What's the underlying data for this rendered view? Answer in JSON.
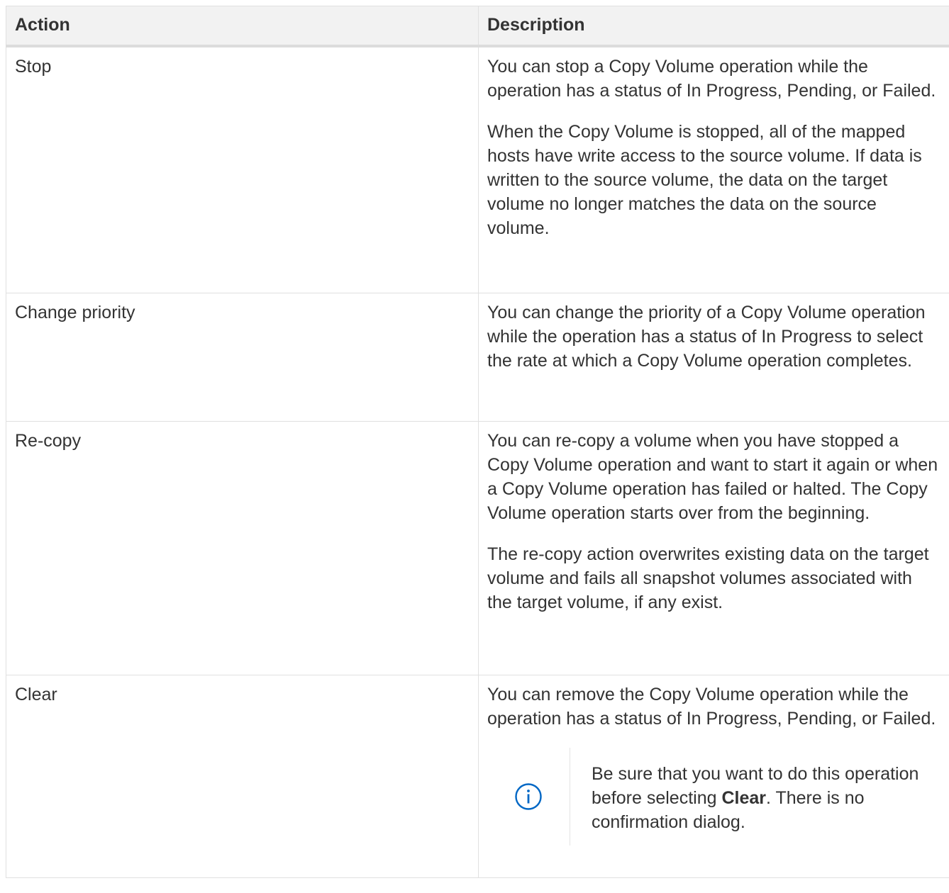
{
  "table": {
    "headers": {
      "action": "Action",
      "description": "Description"
    },
    "rows": [
      {
        "action": "Stop",
        "paragraphs": [
          "You can stop a Copy Volume operation while the operation has a status of In Progress, Pending, or Failed.",
          "When the Copy Volume is stopped, all of the mapped hosts have write access to the source volume. If data is written to the source volume, the data on the target volume no longer matches the data on the source volume."
        ]
      },
      {
        "action": "Change priority",
        "paragraphs": [
          "You can change the priority of a Copy Volume operation while the operation has a status of In Progress to select the rate at which a Copy Volume operation completes."
        ]
      },
      {
        "action": "Re-copy",
        "paragraphs": [
          "You can re-copy a volume when you have stopped a Copy Volume operation and want to start it again or when a Copy Volume operation has failed or halted. The Copy Volume operation starts over from the beginning.",
          "The re-copy action overwrites existing data on the target volume and fails all snapshot volumes associated with the target volume, if any exist."
        ]
      },
      {
        "action": "Clear",
        "paragraphs": [
          "You can remove the Copy Volume operation while the operation has a status of In Progress, Pending, or Failed."
        ],
        "note": {
          "icon": "info-icon",
          "text_before": "Be sure that you want to do this operation before selecting ",
          "bold": "Clear",
          "text_after": ". There is no confirmation dialog."
        }
      }
    ]
  },
  "colors": {
    "text": "#333333",
    "header_bg": "#f2f2f2",
    "border": "#e0e0e0",
    "icon": "#0067c5"
  }
}
